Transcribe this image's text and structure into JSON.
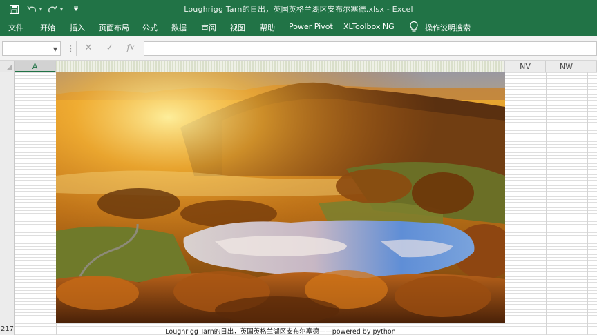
{
  "window": {
    "title": "Loughrigg Tarn的日出，英国英格兰湖区安布尔塞德.xlsx  -  Excel",
    "accent_color": "#217346"
  },
  "quick_access": {
    "icons": [
      "save-icon",
      "undo-icon",
      "redo-icon",
      "customize-icon"
    ]
  },
  "ribbon": {
    "tabs": [
      "文件",
      "开始",
      "插入",
      "页面布局",
      "公式",
      "数据",
      "审阅",
      "视图",
      "帮助",
      "Power Pivot",
      "XLToolbox NG"
    ],
    "tell_me": "操作说明搜索"
  },
  "formula_bar": {
    "name_box": "",
    "formula": "",
    "fx_label": "fx",
    "cancel_symbol": "✕",
    "enter_symbol": "✓"
  },
  "grid": {
    "columns": [
      "A",
      "NV",
      "NW"
    ],
    "row_number": "217",
    "caption": "Loughrigg Tarn的日出，英国英格兰湖区安布尔塞德——powered by python"
  }
}
